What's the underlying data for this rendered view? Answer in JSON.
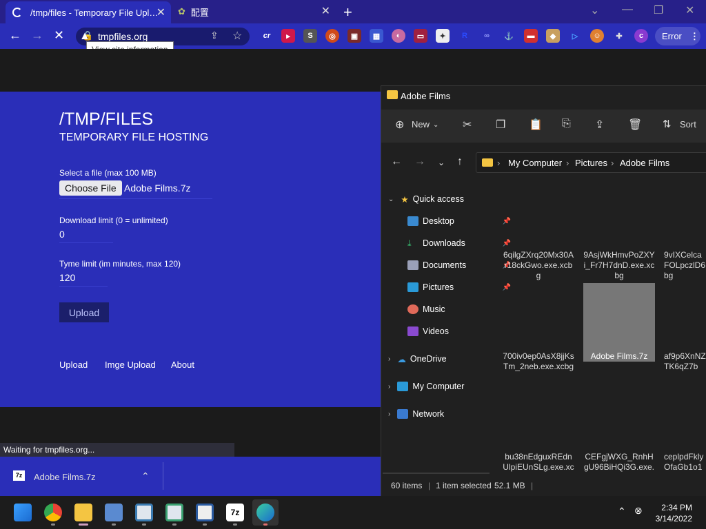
{
  "browser": {
    "tabs": [
      {
        "title": "/tmp/files - Temporary File Uplo..."
      },
      {
        "title": "配置"
      }
    ],
    "url": "tmpfiles.org",
    "tooltip": "View site information",
    "error_button": "Error",
    "status_text": "Waiting for tmpfiles.org..."
  },
  "page": {
    "title": "/TMP/FILES",
    "subtitle": "TEMPORARY FILE HOSTING",
    "file_label": "Select a file (max 100 MB)",
    "choose_file": "Choose File",
    "chosen_file": "Adobe Films.7z",
    "download_limit_label": "Download limit (0 = unlimited)",
    "download_limit_value": "0",
    "time_limit_label": "Tyme limit (im minutes, max 120)",
    "time_limit_value": "120",
    "upload_button": "Upload",
    "footer_links": [
      "Upload",
      "Imge Upload",
      "About"
    ]
  },
  "download_bar": {
    "file": "Adobe Films.7z"
  },
  "explorer": {
    "title": "Adobe Films",
    "new_label": "New",
    "sort_label": "Sort",
    "breadcrumb": [
      "My Computer",
      "Pictures",
      "Adobe Films"
    ],
    "nav": {
      "quick_access": "Quick access",
      "items": [
        "Desktop",
        "Downloads",
        "Documents",
        "Pictures",
        "Music",
        "Videos"
      ],
      "onedrive": "OneDrive",
      "my_computer": "My Computer",
      "network": "Network"
    },
    "files": [
      "6qilgZXrq20Mx30Ar18ckGwo.exe.xcbg",
      "9AsjWkHmvPoZXYi_Fr7H7dnD.exe.xcbg",
      "9vIXCelcaFOLpczlD6bg",
      "700iv0ep0AsX8jjKsTm_2neb.exe.xcbg",
      "Adobe Films.7z",
      "af9p6XnNZTK6qZ7b",
      "bu38nEdguxREdnUlpiEUnSLg.exe.xcbg",
      "CEFgjWXG_RnhHgU96BiHQi3G.exe.xcbg",
      "ceplpdFklyOfaGb1o1"
    ],
    "status": {
      "count": "60 items",
      "selected": "1 item selected",
      "size": "52.1 MB"
    }
  },
  "taskbar": {
    "time": "2:34 PM",
    "date": "3/14/2022"
  }
}
